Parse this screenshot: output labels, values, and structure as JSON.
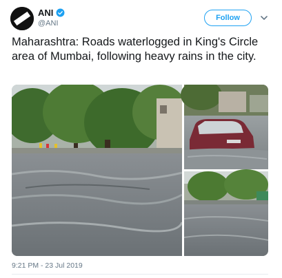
{
  "author": {
    "name": "ANI",
    "handle": "@ANI",
    "avatar_text": "ANI",
    "verified": true
  },
  "follow_button": {
    "label": "Follow"
  },
  "menu": {
    "icon": "chevron-down-icon"
  },
  "tweet": {
    "text": "Maharashtra: Roads waterlogged in King's Circle area of Mumbai, following heavy rains in the city.",
    "timestamp": "9:21 PM - 23 Jul 2019"
  },
  "colors": {
    "accent": "#1da1f2",
    "text": "#14171a",
    "secondary": "#657786",
    "divider": "#e6ecf0"
  }
}
